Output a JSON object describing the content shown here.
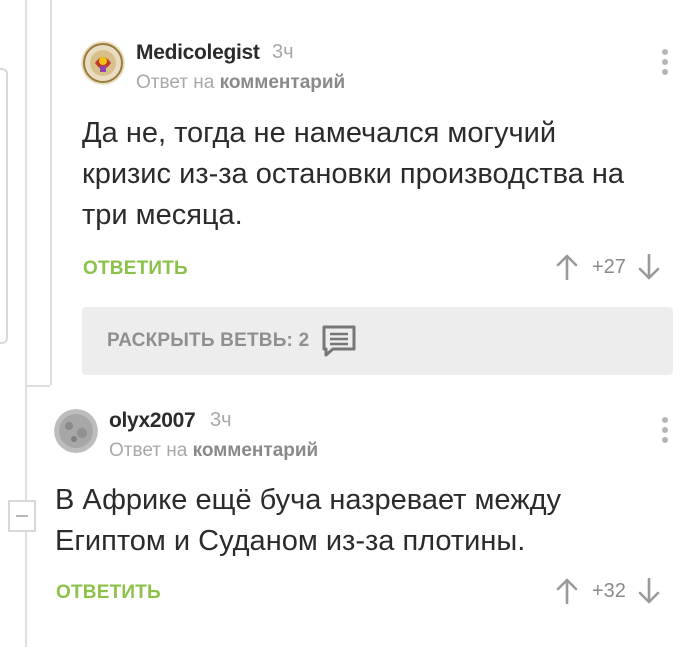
{
  "comments": [
    {
      "username": "Medicolegist",
      "time": "3ч",
      "reply_prefix": "Ответ на",
      "reply_target": "комментарий",
      "text_lines": [
        "Да не, тогда не намечался могучий",
        "кризис из-за остановки производства на",
        "три месяца."
      ],
      "reply_label": "ОТВЕТИТЬ",
      "score": "+27"
    },
    {
      "username": "olyx2007",
      "time": "3ч",
      "reply_prefix": "Ответ на",
      "reply_target": "комментарий",
      "text_lines": [
        "В Африке ещё буча назревает между",
        "Египтом и Суданом из-за плотины."
      ],
      "reply_label": "ОТВЕТИТЬ",
      "score": "+32"
    }
  ],
  "expand_thread": {
    "label": "РАСКРЫТЬ ВЕТВЬ: 2",
    "icon": "comment-lines-icon"
  },
  "colors": {
    "accent_green": "#8cc24a",
    "text": "#2b2b2b",
    "muted": "#a8a8a8"
  }
}
